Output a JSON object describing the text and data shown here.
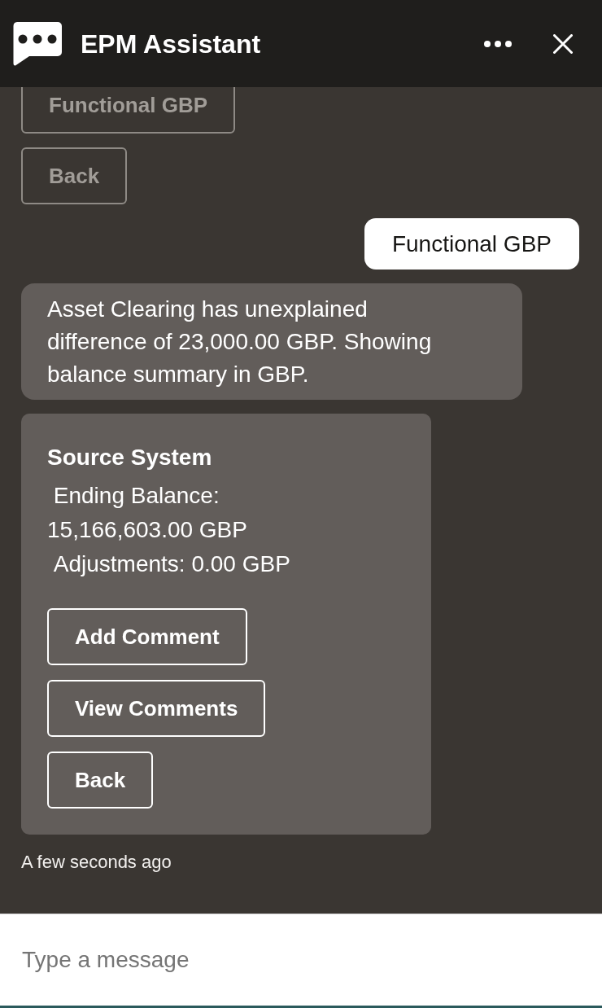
{
  "header": {
    "title": "EPM Assistant"
  },
  "messages": [
    {
      "kind": "actions",
      "buttons": [
        {
          "label": "Functional GBP",
          "disabled": true
        },
        {
          "label": "Back",
          "disabled": true
        }
      ]
    },
    {
      "kind": "user",
      "text": "Functional GBP"
    },
    {
      "kind": "bot",
      "text": "Asset Clearing has unexplained difference of 23,000.00 GBP. Showing balance summary in GBP."
    },
    {
      "kind": "card",
      "title": "Source System",
      "lines": [
        " Ending Balance: 15,166,603.00 GBP",
        " Adjustments: 0.00 GBP"
      ],
      "buttons": [
        {
          "label": "Add Comment",
          "disabled": false
        },
        {
          "label": "View Comments",
          "disabled": false
        },
        {
          "label": "Back",
          "disabled": false
        }
      ]
    }
  ],
  "timestamp": "A few seconds ago",
  "composer": {
    "placeholder": "Type a message"
  }
}
